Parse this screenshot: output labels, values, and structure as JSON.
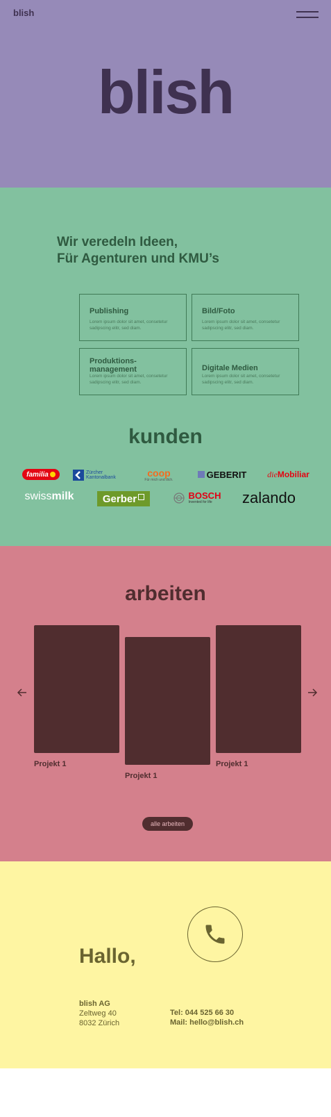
{
  "header": {
    "logo_small": "blish",
    "menu_icon": "hamburger-menu-icon"
  },
  "hero": {
    "title": "blish"
  },
  "services": {
    "tagline_line1": "Wir veredeln Ideen,",
    "tagline_line2": "Für Agenturen und KMU’s",
    "cards": [
      {
        "title": "Publishing",
        "desc": "Lorem ipsum dolor sit amet, consetetur sadipscing elitr, sed diam."
      },
      {
        "title": "Bild/Foto",
        "desc": "Lorem ipsum dolor sit amet, consetetur sadipscing elitr, sed diam."
      },
      {
        "title_line1": "Produktions-",
        "title_line2": "management",
        "desc": "Lorem ipsum dolor sit amet, consetetur sadipscing elitr, sed diam."
      },
      {
        "title": "Digitale Medien",
        "desc": "Lorem ipsum dolor sit amet, consetetur sadipscing elitr, sed diam."
      }
    ]
  },
  "clients": {
    "heading": "kunden",
    "logos": {
      "familia": "familia",
      "zkb_line1": "Zürcher",
      "zkb_line2": "Kantonalbank",
      "coop": "coop",
      "coop_slogan": "Für mich und dich.",
      "geberit": "GEBERIT",
      "mobiliar_die": "die",
      "mobiliar": "Mobiliar",
      "swissmilk_a": "swiss",
      "swissmilk_b": "milk",
      "gerber": "Gerber",
      "bosch": "BOSCH",
      "bosch_slogan": "Invented for life",
      "zalando": "zalando"
    }
  },
  "works": {
    "heading": "arbeiten",
    "projects": [
      {
        "label": "Projekt 1"
      },
      {
        "label": "Projekt 1"
      },
      {
        "label": "Projekt 1"
      }
    ],
    "button": "alle arbeiten",
    "prev_icon": "arrow-left-icon",
    "next_icon": "arrow-right-icon"
  },
  "contact": {
    "greeting": "Hallo,",
    "company": "blish AG",
    "street": "Zeltweg 40",
    "city": "8032 Zürich",
    "tel": "Tel: 044 525 66 30",
    "mail": "Mail: hello@blish.ch",
    "phone_icon": "phone-icon"
  },
  "colors": {
    "hero_bg": "#968ab8",
    "services_bg": "#82c19f",
    "works_bg": "#d4808c",
    "contact_bg": "#fef5a2"
  }
}
